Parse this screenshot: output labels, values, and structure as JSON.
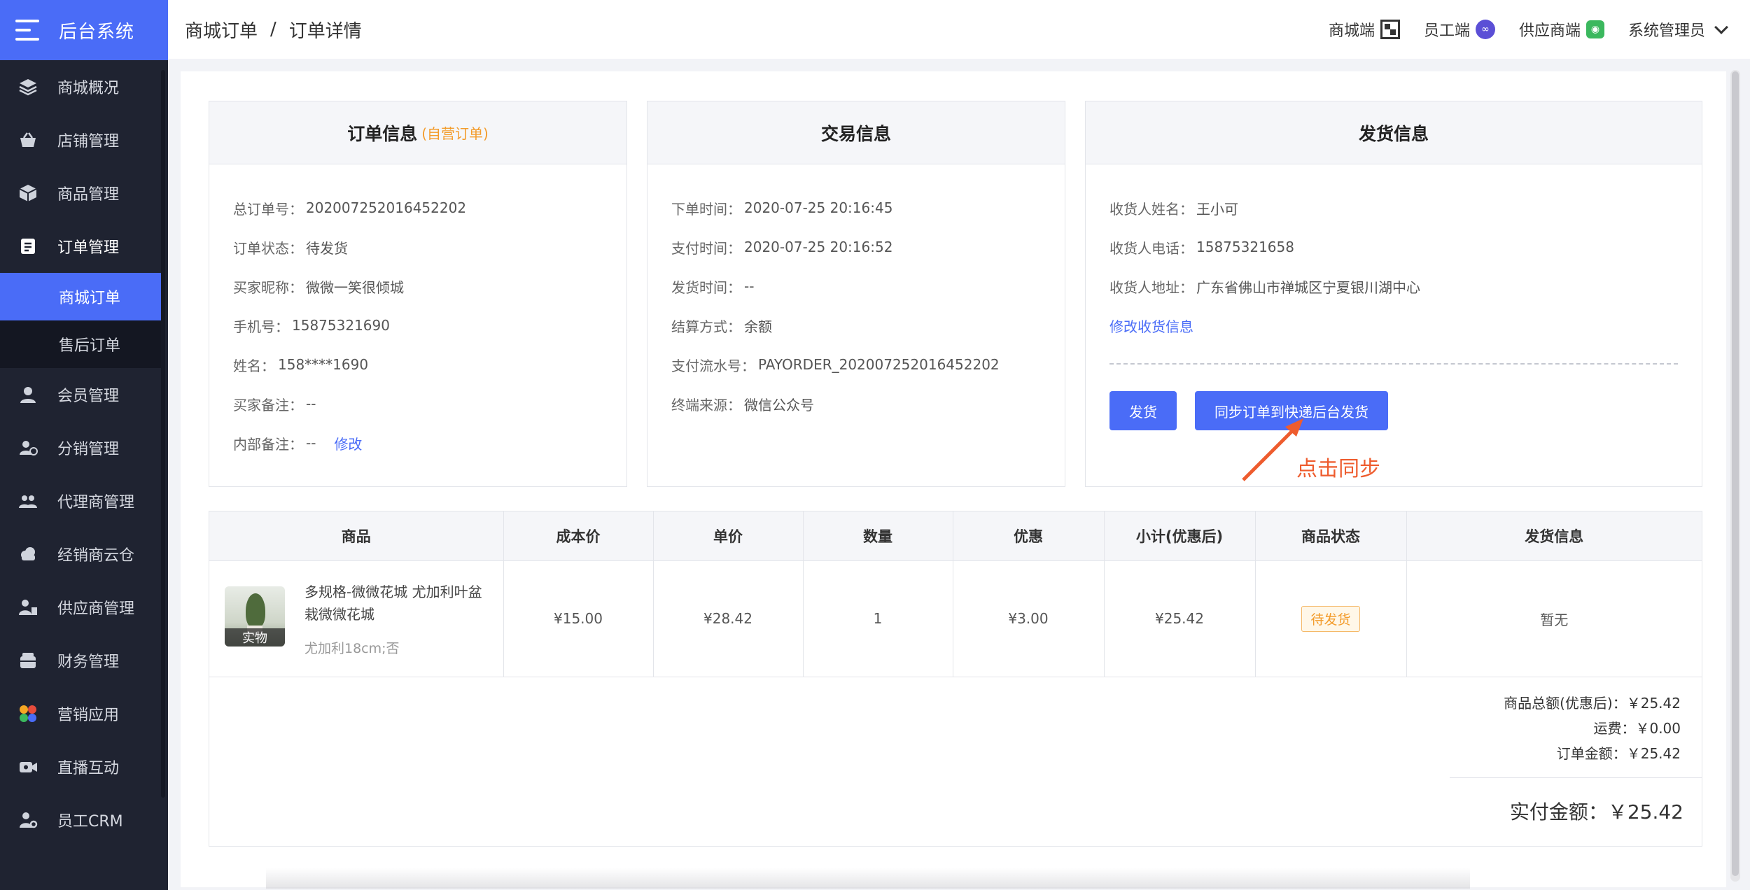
{
  "app": {
    "title": "后台系统"
  },
  "sidebar": {
    "items": [
      {
        "label": "商城概况",
        "icon": "layers-icon"
      },
      {
        "label": "店铺管理",
        "icon": "basket-icon"
      },
      {
        "label": "商品管理",
        "icon": "box-icon"
      },
      {
        "label": "订单管理",
        "icon": "order-icon"
      },
      {
        "label": "会员管理",
        "icon": "user-icon"
      },
      {
        "label": "分销管理",
        "icon": "distribution-icon"
      },
      {
        "label": "代理商管理",
        "icon": "agent-icon"
      },
      {
        "label": "经销商云仓",
        "icon": "cloud-warehouse-icon"
      },
      {
        "label": "供应商管理",
        "icon": "supplier-icon"
      },
      {
        "label": "财务管理",
        "icon": "finance-icon"
      },
      {
        "label": "营销应用",
        "icon": "marketing-icon"
      },
      {
        "label": "直播互动",
        "icon": "video-icon"
      },
      {
        "label": "员工CRM",
        "icon": "crm-icon"
      }
    ],
    "sub_items": [
      {
        "label": "商城订单"
      },
      {
        "label": "售后订单"
      }
    ]
  },
  "header": {
    "breadcrumb": [
      "商城订单",
      "订单详情"
    ],
    "separator": "/",
    "right": {
      "mall_end": "商城端",
      "staff_end": "员工端",
      "supply_mall": "供应商端",
      "admin": "系统管理员"
    }
  },
  "order_info": {
    "title": "订单信息",
    "tag": "(自营订单)",
    "rows": [
      {
        "k": "总订单号：",
        "v": "202007252016452202"
      },
      {
        "k": "订单状态：",
        "v": "待发货"
      },
      {
        "k": "买家昵称：",
        "v": "微微一笑很倾城"
      },
      {
        "k": "手机号：",
        "v": "15875321690"
      },
      {
        "k": "姓名：",
        "v": "158****1690"
      },
      {
        "k": "买家备注：",
        "v": "--"
      },
      {
        "k": "内部备注：",
        "v": "--"
      }
    ],
    "edit_link": "修改"
  },
  "trade_info": {
    "title": "交易信息",
    "rows": [
      {
        "k": "下单时间：",
        "v": "2020-07-25 20:16:45"
      },
      {
        "k": "支付时间：",
        "v": "2020-07-25 20:16:52"
      },
      {
        "k": "发货时间：",
        "v": "--"
      },
      {
        "k": "结算方式：",
        "v": "余额"
      },
      {
        "k": "支付流水号：",
        "v": "PAYORDER_202007252016452202"
      },
      {
        "k": "终端来源：",
        "v": "微信公众号"
      }
    ]
  },
  "ship_info": {
    "title": "发货信息",
    "rows": [
      {
        "k": "收货人姓名：",
        "v": "王小可"
      },
      {
        "k": "收货人电话：",
        "v": "15875321658"
      },
      {
        "k": "收货人地址：",
        "v": "广东省佛山市禅城区宁夏银川湖中心"
      }
    ],
    "edit_link": "修改收货信息",
    "ship_button": "发货",
    "sync_button": "同步订单到快递后台发货",
    "annotation": "点击同步",
    "annotation_color": "#ee5c2e"
  },
  "table": {
    "headers": [
      "商品",
      "成本价",
      "单价",
      "数量",
      "优惠",
      "小计(优惠后)",
      "商品状态",
      "发货信息"
    ],
    "row": {
      "badge": "实物",
      "name": "多规格-微微花城 尤加利叶盆栽微微花城",
      "spec": "尤加利18cm;否",
      "cost": "¥15.00",
      "price": "¥28.42",
      "qty": "1",
      "discount": "¥3.00",
      "subtotal": "¥25.42",
      "status": "待发货",
      "ship": "暂无"
    }
  },
  "summary": {
    "goods_total": "商品总额(优惠后)：￥25.42",
    "freight": "运费：￥0.00",
    "order_amount": "订单金额：￥25.42",
    "paid": "实付金额：￥25.42"
  },
  "colors": {
    "accent": "#4a6cf7",
    "sidebar": "#1f2331",
    "warning": "#f39c2c"
  }
}
